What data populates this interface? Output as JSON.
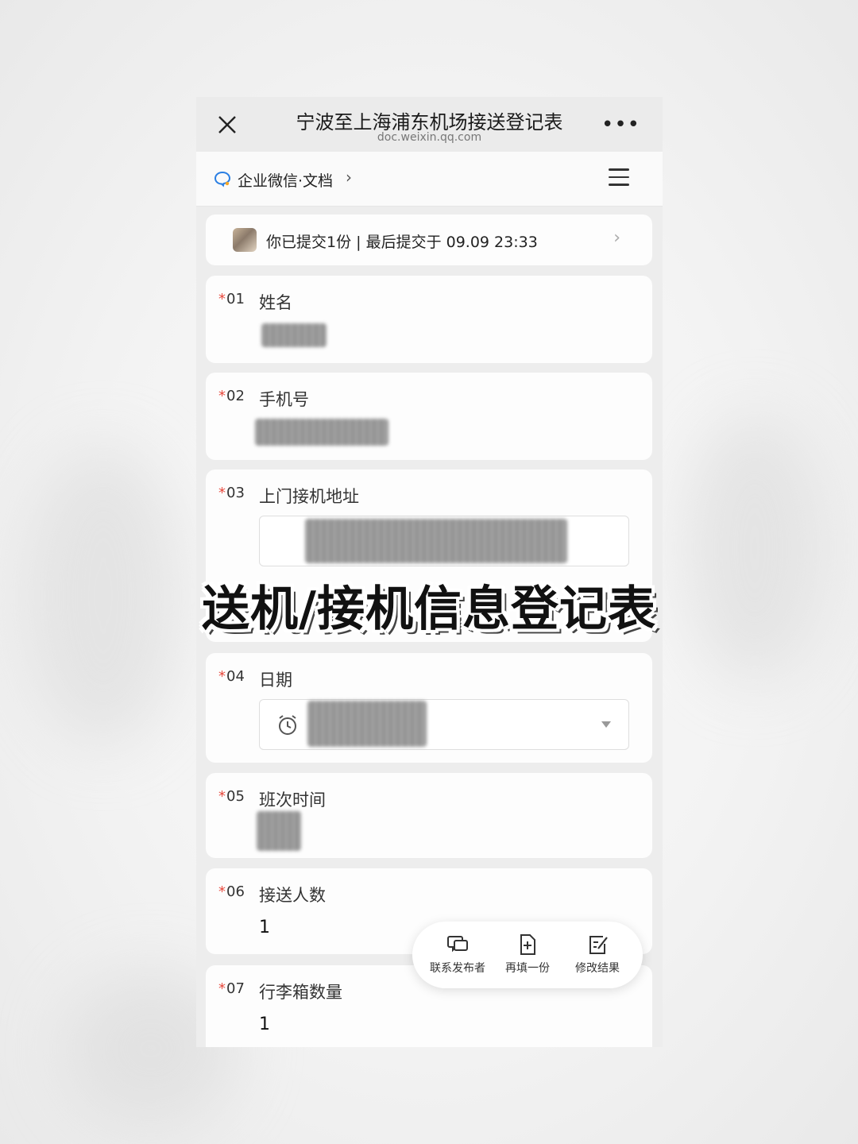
{
  "header": {
    "title": "宁波至上海浦东机场接送登记表",
    "url": "doc.weixin.qq.com"
  },
  "docbar": {
    "label": "企业微信·文档",
    "chevron": "›"
  },
  "submission": {
    "text": "你已提交1份 | 最后提交于 09.09 23:33",
    "chevron": "›"
  },
  "questions": [
    {
      "num": "01",
      "label": "姓名",
      "value": ""
    },
    {
      "num": "02",
      "label": "手机号",
      "value": ""
    },
    {
      "num": "03",
      "label": "上门接机地址",
      "value": ""
    },
    {
      "num": "04",
      "label": "日期",
      "value": ""
    },
    {
      "num": "05",
      "label": "班次时间",
      "value": ""
    },
    {
      "num": "06",
      "label": "接送人数",
      "value": "1"
    },
    {
      "num": "07",
      "label": "行李箱数量",
      "value": "1"
    }
  ],
  "required_mark": "*",
  "overlay": {
    "title": "送机/接机信息登记表"
  },
  "floating_actions": [
    {
      "label": "联系发布者",
      "icon": "chat-icon"
    },
    {
      "label": "再填一份",
      "icon": "add-file-icon"
    },
    {
      "label": "修改结果",
      "icon": "edit-icon"
    }
  ],
  "colors": {
    "required": "#e8493d",
    "background": "#ededed",
    "card": "#fdfdfd"
  }
}
